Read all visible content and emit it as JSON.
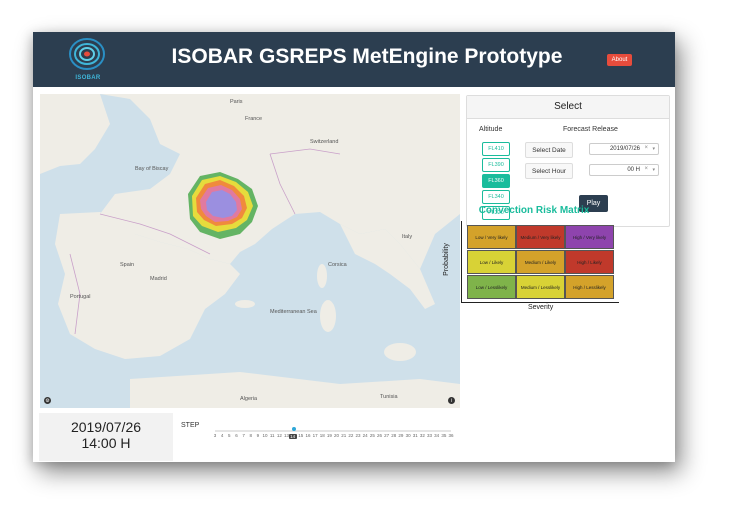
{
  "header": {
    "title": "ISOBAR GSREPS MetEngine Prototype",
    "logo_text": "ISOBAR",
    "about_label": "About",
    "bg_color": "#2c3e50",
    "about_color": "#e74c3c"
  },
  "map": {
    "labels": [
      "France",
      "Switzerland",
      "Italy",
      "Spain",
      "Portugal",
      "Madrid",
      "Paris",
      "Mediterranean Sea",
      "Tunisia",
      "Algeria",
      "Bay of Biscay",
      "Corsica"
    ]
  },
  "select_panel": {
    "title": "Select",
    "altitude_title": "Altitude",
    "altitudes": [
      "FL410",
      "FL390",
      "FL360",
      "FL340",
      "FL320"
    ],
    "selected_altitude": "FL360",
    "forecast_title": "Forecast Release",
    "date_label": "Select Date",
    "date_value": "2019/07/26",
    "hour_label": "Select Hour",
    "hour_value": "00 H",
    "clear_icon": "×",
    "caret_icon": "▾",
    "play_label": "Play"
  },
  "risk_matrix": {
    "title": "Convection Risk Matrix",
    "ylabel": "Probability",
    "xlabel": "Severity",
    "rows": [
      [
        "Low / Very likely",
        "Medium / Very likely",
        "High / Very likely"
      ],
      [
        "Low / Likely",
        "Medium / Likely",
        "High / Likely"
      ],
      [
        "Low / Lesslikely",
        "Medium / Lesslikely",
        "High / Lesslikely"
      ]
    ],
    "colors": [
      [
        "#d4a22a",
        "#c0392b",
        "#8e44ad"
      ],
      [
        "#d8d236",
        "#d4a22a",
        "#c0392b"
      ],
      [
        "#7fb34a",
        "#d8d236",
        "#d4a22a"
      ]
    ]
  },
  "datetime": {
    "date": "2019/07/26",
    "time": "14:00 H"
  },
  "step": {
    "title": "STEP",
    "ticks": [
      "3",
      "4",
      "5",
      "6",
      "7",
      "8",
      "9",
      "10",
      "11",
      "12",
      "13",
      "14",
      "15",
      "16",
      "17",
      "18",
      "19",
      "20",
      "21",
      "22",
      "23",
      "24",
      "25",
      "26",
      "27",
      "28",
      "29",
      "30",
      "31",
      "32",
      "33",
      "34",
      "35",
      "36"
    ],
    "current": "14"
  }
}
